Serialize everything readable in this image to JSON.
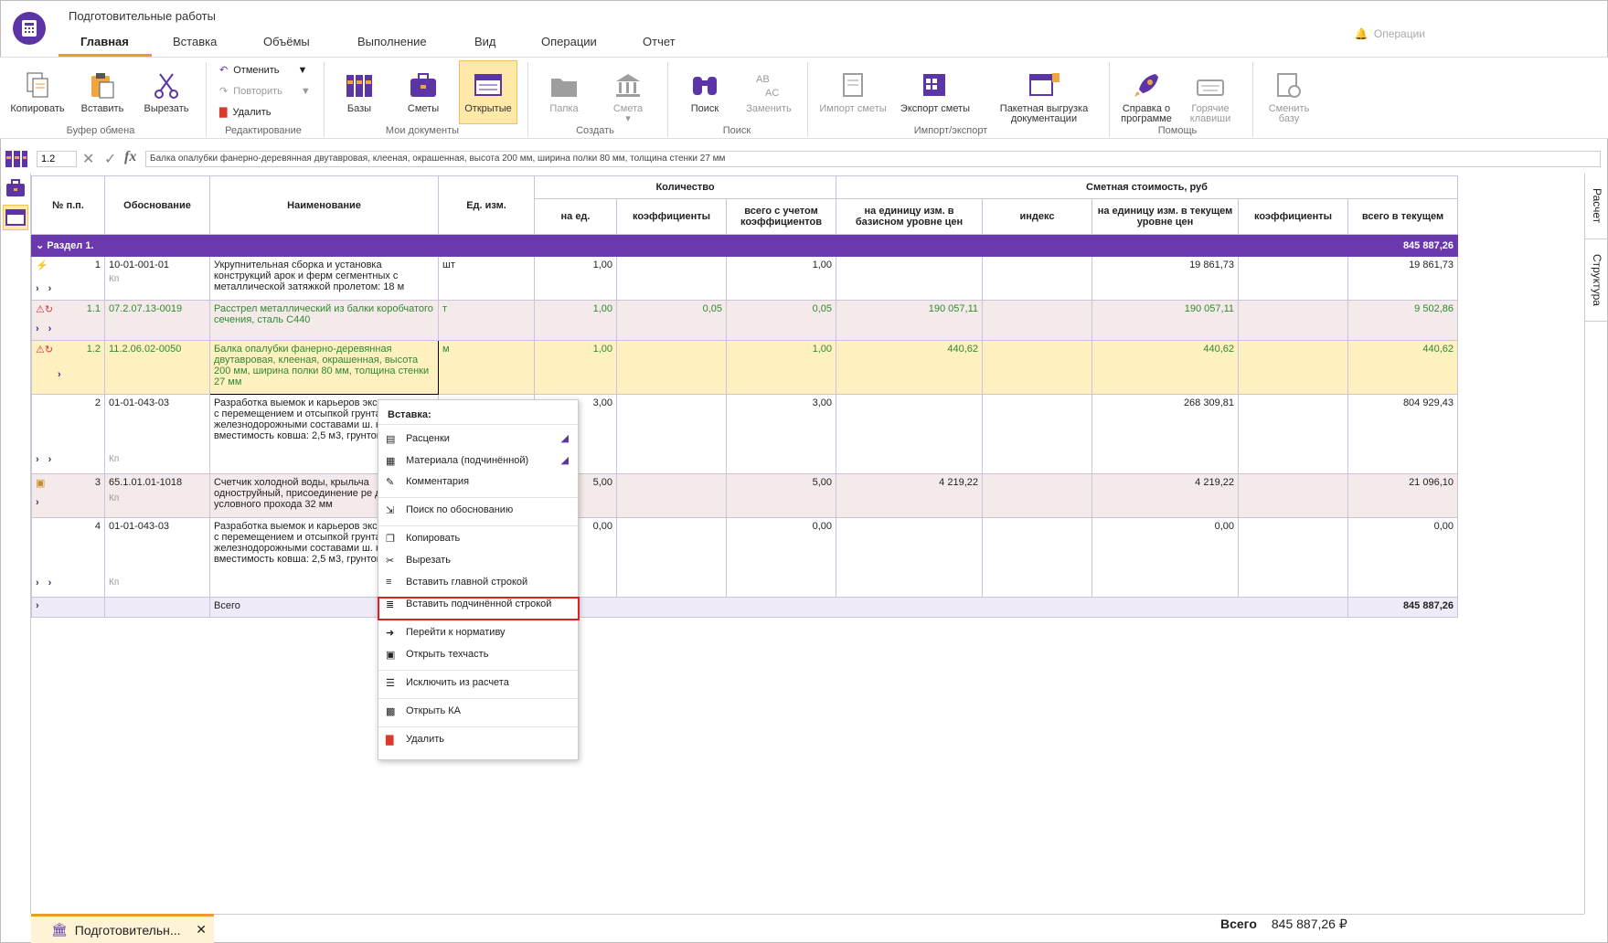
{
  "app": {
    "title": "Подготовительные работы",
    "operations": "Операции"
  },
  "tabs": [
    "Главная",
    "Вставка",
    "Объёмы",
    "Выполнение",
    "Вид",
    "Операции",
    "Отчет"
  ],
  "ribbon": {
    "copy": "Копировать",
    "paste": "Вставить",
    "cut": "Вырезать",
    "clipboard_group": "Буфер обмена",
    "undo": "Отменить",
    "redo": "Повторить",
    "delete": "Удалить",
    "edit_group": "Редактирование",
    "bases": "Базы",
    "estimates": "Сметы",
    "open": "Открытые",
    "docs_group": "Мои документы",
    "folder": "Папка",
    "estimate": "Смета",
    "create_group": "Создать",
    "search": "Поиск",
    "replace": "Заменить",
    "search_group": "Поиск",
    "import": "Импорт сметы",
    "export": "Экспорт сметы",
    "batch1": "Пакетная выгрузка",
    "batch2": "документации",
    "ie_group": "Импорт/экспорт",
    "help1": "Справка о",
    "help2": "программе",
    "hot1": "Горячие",
    "hot2": "клавиши",
    "help_group": "Помощь",
    "change1": "Сменить",
    "change2": "базу"
  },
  "formula": {
    "ref": "1.2",
    "text": "Балка опалубки фанерно-деревянная двутавровая, клееная, окрашенная, высота 200 мм, ширина полки 80 мм, толщина стенки 27 мм"
  },
  "side": {
    "calc": "Расчет",
    "struct": "Структура"
  },
  "headers": {
    "num": "№ п.п.",
    "basis": "Обоснование",
    "name": "Наименование",
    "unit": "Ед. изм.",
    "qty": "Количество",
    "per_unit": "на ед.",
    "coef": "коэффициенты",
    "total_coef": "всего с учетом коэффициентов",
    "cost": "Сметная стоимость, руб",
    "unit_base": "на единицу изм. в базисном уровне цен",
    "index": "индекс",
    "unit_cur": "на единицу изм. в текущем уровне цен",
    "coef2": "коэффициенты",
    "total_cur": "всего в текущем"
  },
  "section": {
    "label": "Раздел 1.",
    "total": "845 887,26"
  },
  "rows": [
    {
      "n": "1",
      "basis": "10-01-001-01",
      "name": "Укрупнительная сборка и установка конструкций арок и ферм сегментных с металлической затяжкой пролетом: 18 м",
      "unit": "шт",
      "pu": "1,00",
      "coef": "",
      "tc": "1,00",
      "ub": "",
      "idx": "",
      "uc": "19 861,73",
      "c2": "",
      "tot": "19 861,73"
    },
    {
      "n": "1.1",
      "basis": "07.2.07.13-0019",
      "name": "Расстрел металлический из балки коробчатого сечения, сталь С440",
      "unit": "т",
      "pu": "1,00",
      "coef": "0,05",
      "tc": "0,05",
      "ub": "190 057,11",
      "idx": "",
      "uc": "190 057,11",
      "c2": "",
      "tot": "9 502,86"
    },
    {
      "n": "1.2",
      "basis": "11.2.06.02-0050",
      "name": "Балка опалубки фанерно-деревянная двутавровая, клееная, окрашенная, высота 200 мм, ширина полки 80 мм, толщина стенки 27 мм",
      "unit": "м",
      "pu": "1,00",
      "coef": "",
      "tc": "1,00",
      "ub": "440,62",
      "idx": "",
      "uc": "440,62",
      "c2": "",
      "tot": "440,62"
    },
    {
      "n": "2",
      "basis": "01-01-043-03",
      "name": "Разработка выемок и карьеров экскаваторами с перемещением и отсыпкой грунта в насыпи железнодорожными составами ш. колеи, вместимость ковша: 2,5 м3, грунтов 3",
      "unit": "",
      "pu": "3,00",
      "coef": "",
      "tc": "3,00",
      "ub": "",
      "idx": "",
      "uc": "268 309,81",
      "c2": "",
      "tot": "804 929,43"
    },
    {
      "n": "3",
      "basis": "65.1.01.01-1018",
      "name": "Счетчик холодной воды, крыльча одноструйный, присоединение ре диаметр условного прохода 32 мм",
      "unit": "",
      "pu": "5,00",
      "coef": "",
      "tc": "5,00",
      "ub": "4 219,22",
      "idx": "",
      "uc": "4 219,22",
      "c2": "",
      "tot": "21 096,10"
    },
    {
      "n": "4",
      "basis": "01-01-043-03",
      "name": "Разработка выемок и карьеров экскаваторами с перемещением и отсыпкой грунта в насыпи железнодорожными составами ш. колеи, вместимость ковша: 2,5 м3, грунтов 3",
      "unit": "",
      "pu": "0,00",
      "coef": "",
      "tc": "0,00",
      "ub": "",
      "idx": "",
      "uc": "0,00",
      "c2": "",
      "tot": "0,00"
    }
  ],
  "kp": "Кп",
  "total_row": {
    "label": "Всего",
    "value": "845 887,26"
  },
  "menu": {
    "header": "Вставка:",
    "items": [
      "Расценки",
      "Материала (подчинённой)",
      "Комментария",
      "Поиск по обоснованию",
      "Копировать",
      "Вырезать",
      "Вставить главной строкой",
      "Вставить подчинённой строкой",
      "Перейти к нормативу",
      "Открыть техчасть",
      "Исключить из расчета",
      "Открыть КА",
      "Удалить"
    ]
  },
  "bottom": {
    "doc": "Подготовительн...",
    "total_label": "Всего",
    "total_value": "845 887,26 ₽"
  }
}
